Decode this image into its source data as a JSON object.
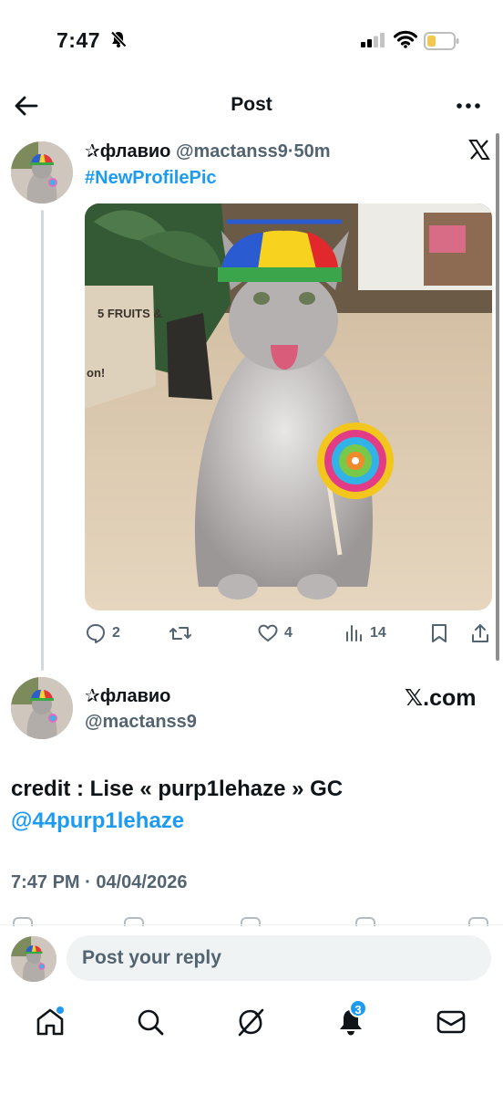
{
  "status_bar": {
    "time": "7:47"
  },
  "header": {
    "title": "Post"
  },
  "first_post": {
    "display_name": "✰флавио",
    "handle": "@mactanss9",
    "separator": "·",
    "age": "50m",
    "hashtag": "#NewProfilePic",
    "photo_bag_text": [
      "5 FRUITS &",
      "on!"
    ],
    "actions": {
      "replies": "2",
      "reposts": "",
      "likes": "4",
      "views": "14"
    }
  },
  "main_post": {
    "display_name": "✰флавио",
    "handle": "@mactanss9",
    "badge": "𝕏.com",
    "text": "credit : Lise « purp1lehaze » GC",
    "mention": "@44purp1lehaze",
    "timestamp": "7:47 PM · 04/04/2026"
  },
  "reply": {
    "placeholder": "Post your reply"
  },
  "tabbar": {
    "notifications_count": "3"
  },
  "colors": {
    "accent": "#1d9bf0",
    "secondary_text": "#536471",
    "primary_text": "#0f1419",
    "input_bg": "#eff3f4"
  },
  "icons": [
    "bell-off-icon",
    "signal-icon",
    "wifi-icon",
    "battery-icon",
    "back-arrow-icon",
    "more-icon",
    "x-logo-icon",
    "reply-icon",
    "repost-icon",
    "like-icon",
    "views-icon",
    "bookmark-icon",
    "share-icon",
    "home-icon",
    "search-icon",
    "grok-icon",
    "notifications-icon",
    "messages-icon"
  ]
}
